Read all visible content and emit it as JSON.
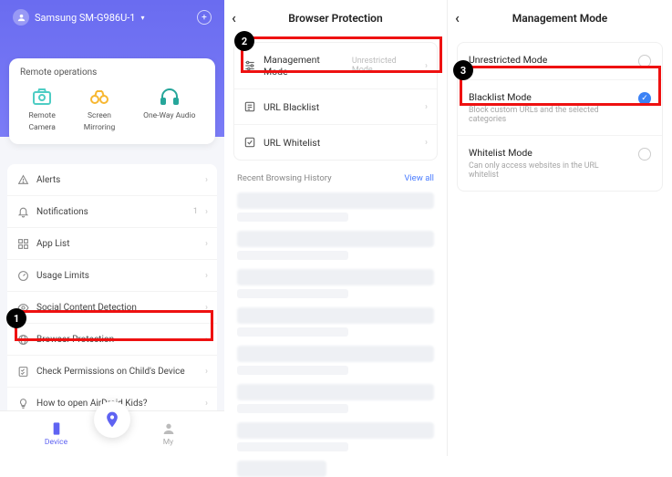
{
  "col1": {
    "device_name": "Samsung SM-G986U-1",
    "remote_title": "Remote operations",
    "remote_items": [
      {
        "label1": "Remote",
        "label2": "Camera"
      },
      {
        "label1": "Screen",
        "label2": "Mirroring"
      },
      {
        "label1": "One-Way Audio",
        "label2": ""
      }
    ],
    "menu": [
      {
        "label": "Alerts",
        "sub": ""
      },
      {
        "label": "Notifications",
        "sub": "1"
      },
      {
        "label": "App List",
        "sub": ""
      },
      {
        "label": "Usage Limits",
        "sub": ""
      },
      {
        "label": "Social Content Detection",
        "sub": ""
      },
      {
        "label": "Browser Protection",
        "sub": ""
      },
      {
        "label": "Check Permissions on Child's Device",
        "sub": ""
      },
      {
        "label": "How to open AirDroid Kids?",
        "sub": ""
      }
    ],
    "tabs": [
      {
        "label": "Device",
        "active": true
      },
      {
        "label": "My",
        "active": false
      }
    ]
  },
  "col2": {
    "title": "Browser Protection",
    "rows": [
      {
        "label": "Management Mode",
        "sub": "Unrestricted Mode"
      },
      {
        "label": "URL Blacklist",
        "sub": ""
      },
      {
        "label": "URL Whitelist",
        "sub": ""
      }
    ],
    "history_label": "Recent Browsing History",
    "view_all": "View all"
  },
  "col3": {
    "title": "Management Mode",
    "modes": [
      {
        "title": "Unrestricted Mode",
        "desc": "",
        "selected": false
      },
      {
        "title": "Blacklist Mode",
        "desc": "Block custom URLs and the selected categories",
        "selected": true
      },
      {
        "title": "Whitelist Mode",
        "desc": "Can only access websites in the URL whitelist",
        "selected": false
      }
    ]
  },
  "steps": {
    "s1": "1",
    "s2": "2",
    "s3": "3"
  }
}
